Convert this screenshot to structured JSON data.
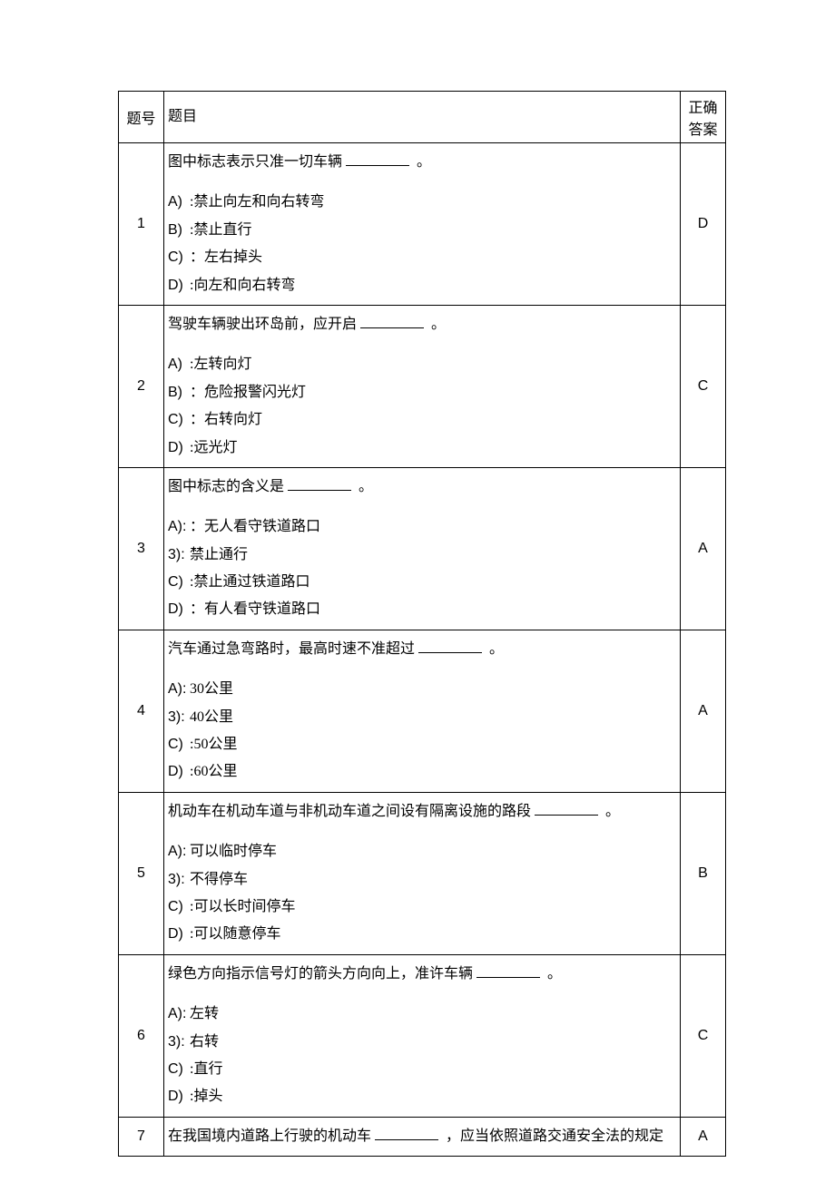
{
  "headers": {
    "num": "题号",
    "question": "题目",
    "answer": "正确答案"
  },
  "rows": [
    {
      "num": "1",
      "stem_pre": "图中标志表示只准一切车辆",
      "stem_post": "。",
      "options": [
        {
          "label": "A)",
          "sep": "  :",
          "text": "禁止向左和向右转弯"
        },
        {
          "label": "B)",
          "sep": "  :",
          "text": "禁止直行"
        },
        {
          "label": "C)",
          "sep": "  ：",
          "text": "左右掉头"
        },
        {
          "label": "D)",
          "sep": "  :",
          "text": "向左和向右转弯"
        }
      ],
      "answer": "D"
    },
    {
      "num": "2",
      "stem_pre": "驾驶车辆驶出环岛前，应开启",
      "stem_post": "。",
      "options": [
        {
          "label": "A)",
          "sep": "  :",
          "text": "左转向灯"
        },
        {
          "label": "B)",
          "sep": "  ：",
          "text": "危险报警闪光灯"
        },
        {
          "label": "C)",
          "sep": "  ：",
          "text": "右转向灯"
        },
        {
          "label": "D)",
          "sep": "  :",
          "text": "远光灯"
        }
      ],
      "answer": "C"
    },
    {
      "num": "3",
      "stem_pre": "图中标志的含义是",
      "stem_post": "。",
      "options": [
        {
          "label": "A):",
          "sep": "：",
          "text": "无人看守铁道路口"
        },
        {
          "label": "3):",
          "sep": "",
          "text": "禁止通行"
        },
        {
          "label": "C)",
          "sep": "  :",
          "text": "禁止通过铁道路口"
        },
        {
          "label": "D)",
          "sep": "  ：",
          "text": "有人看守铁道路口"
        }
      ],
      "answer": "A"
    },
    {
      "num": "4",
      "stem_pre": "汽车通过急弯路时，最高时速不准超过",
      "stem_post": "。",
      "options": [
        {
          "label": "A):",
          "sep": "",
          "text": "30公里"
        },
        {
          "label": "3):",
          "sep": "",
          "text": "40公里"
        },
        {
          "label": "C)",
          "sep": "  :",
          "text": "50公里"
        },
        {
          "label": "D)",
          "sep": "  :",
          "text": "60公里"
        }
      ],
      "answer": "A"
    },
    {
      "num": "5",
      "stem_pre": "机动车在机动车道与非机动车道之间设有隔离设施的路段",
      "stem_post": "。",
      "options": [
        {
          "label": "A):",
          "sep": "",
          "text": "可以临时停车"
        },
        {
          "label": "3):",
          "sep": "",
          "text": "不得停车"
        },
        {
          "label": "C)",
          "sep": "  :",
          "text": "可以长时间停车"
        },
        {
          "label": "D)",
          "sep": "  :",
          "text": "可以随意停车"
        }
      ],
      "answer": "B"
    },
    {
      "num": "6",
      "stem_pre": "绿色方向指示信号灯的箭头方向向上，准许车辆",
      "stem_post": "。",
      "options": [
        {
          "label": "A):",
          "sep": "",
          "text": "左转"
        },
        {
          "label": "3):",
          "sep": "",
          "text": "右转"
        },
        {
          "label": "C)",
          "sep": "  :",
          "text": "直行"
        },
        {
          "label": "D)",
          "sep": "  :",
          "text": "掉头"
        }
      ],
      "answer": "C"
    },
    {
      "num": "7",
      "stem_pre": "在我国境内道路上行驶的机动车",
      "stem_post": "，应当依照道路交通安全法的规定",
      "options": [],
      "answer": "A"
    }
  ]
}
